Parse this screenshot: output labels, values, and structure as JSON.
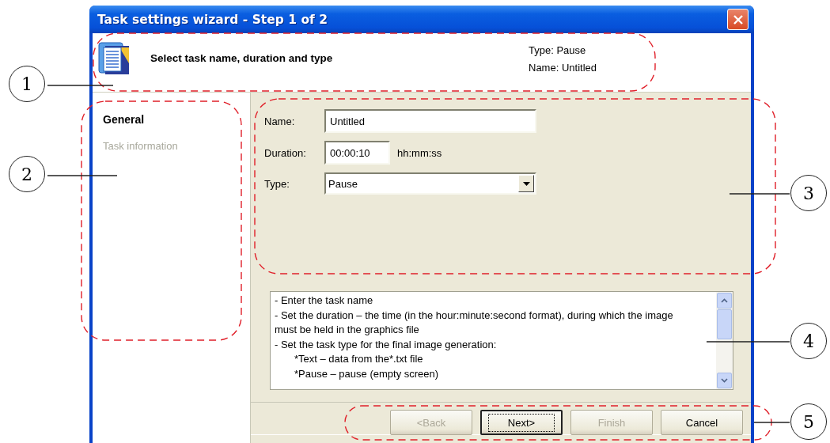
{
  "window": {
    "title": "Task settings wizard - Step 1 of 2"
  },
  "header": {
    "title": "Select task name, duration and type",
    "summary": [
      "Type: Pause",
      "Name: Untitled"
    ]
  },
  "steps": [
    {
      "label": "General",
      "selected": true
    },
    {
      "label": "Task information",
      "selected": false
    }
  ],
  "form": {
    "name": {
      "label": "Name:",
      "value": "Untitled"
    },
    "duration": {
      "label": "Duration:",
      "value": "00:00:10",
      "unit": "hh:mm:ss"
    },
    "type": {
      "label": "Type:",
      "value": "Pause"
    }
  },
  "help": [
    {
      "text": "- Enter the task name",
      "kind": "item"
    },
    {
      "text": "- Set the duration – the time (in the hour:minute:second format), during which the image must be held in the graphics file",
      "kind": "item"
    },
    {
      "text": "- Set the task type for the final image generation:",
      "kind": "item"
    },
    {
      "text": "*Text – data from the*.txt file",
      "kind": "subitem"
    },
    {
      "text": "*Pause – pause (empty screen)",
      "kind": "subitem"
    }
  ],
  "buttons": [
    {
      "label": "<Back",
      "disabled": true,
      "focused": false
    },
    {
      "label": "Next>",
      "disabled": false,
      "focused": true
    },
    {
      "label": "Finish",
      "disabled": true,
      "focused": false
    },
    {
      "label": "Cancel",
      "disabled": false,
      "focused": false
    }
  ],
  "callouts": [
    "1",
    "2",
    "3",
    "4",
    "5"
  ]
}
